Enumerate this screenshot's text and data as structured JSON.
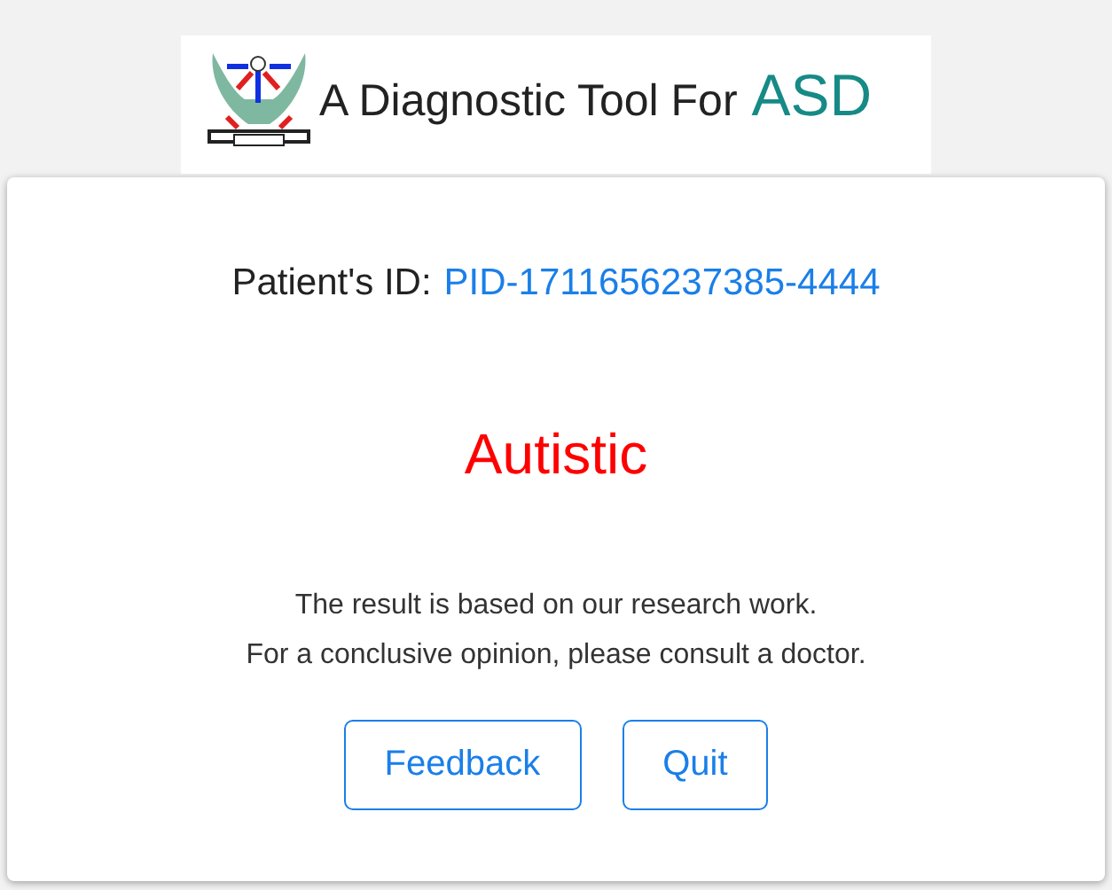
{
  "header": {
    "title": "A Diagnostic Tool For",
    "highlight": "ASD"
  },
  "result": {
    "id_label": "Patient's ID:",
    "patient_id": "PID-1711656237385-4444",
    "diagnosis": "Autistic",
    "notes": [
      "The result is based on our research work.",
      "For a conclusive opinion, please consult a doctor."
    ]
  },
  "buttons": [
    "Feedback",
    "Quit"
  ]
}
